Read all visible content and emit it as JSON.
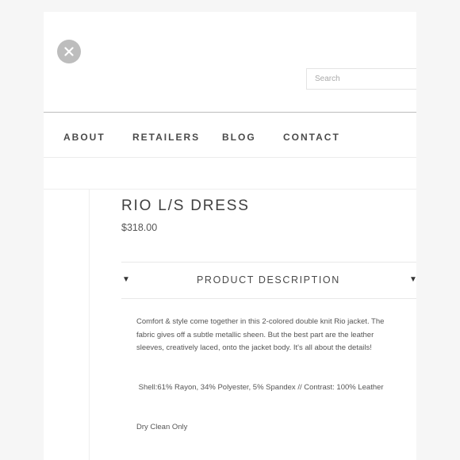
{
  "header": {
    "close_icon": "close-icon",
    "search_placeholder": "Search"
  },
  "nav": {
    "items": [
      {
        "label": "ABOUT"
      },
      {
        "label": "RETAILERS"
      },
      {
        "label": "BLOG"
      },
      {
        "label": "CONTACT"
      }
    ]
  },
  "product": {
    "title": "RIO L/S DRESS",
    "price": "$318.00",
    "accordion": {
      "label": "PRODUCT DESCRIPTION",
      "arrow_icon": "triangle-down-icon"
    },
    "description": [
      "Comfort & style come together in this 2-colored double knit Rio jacket. The fabric gives off a subtle metallic sheen. But the best part are the leather sleeves, creatively laced, onto the jacket body. It's all about the details!",
      " Shell:61% Rayon, 34% Polyester, 5% Spandex // Contrast: 100% Leather",
      "Dry Clean Only"
    ]
  },
  "colors": {
    "background": "#f6f6f6",
    "page": "#ffffff",
    "close_button": "#bdbdbd",
    "text": "#4a4a4a"
  }
}
